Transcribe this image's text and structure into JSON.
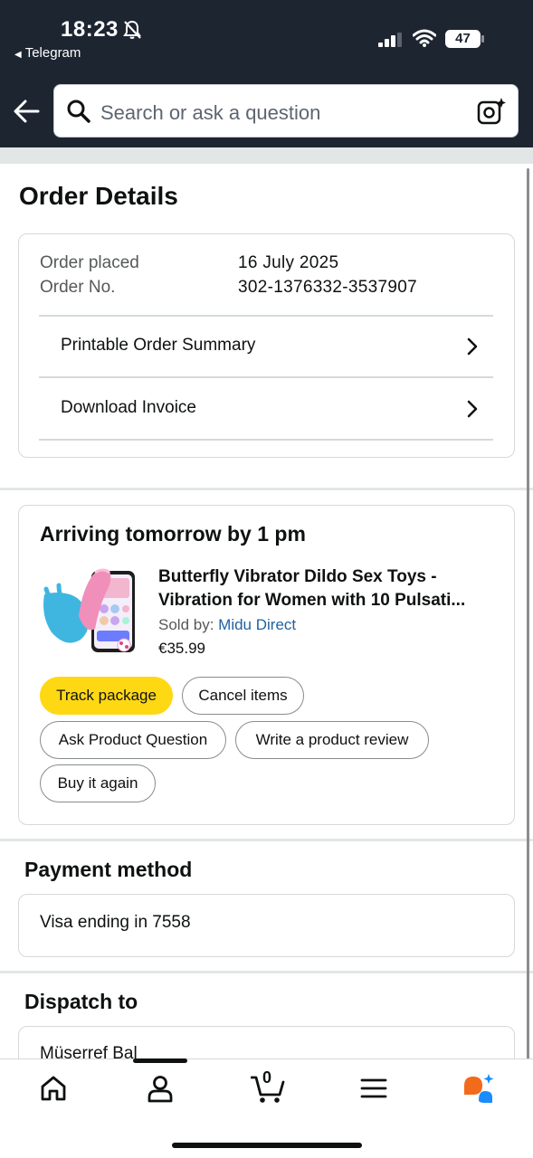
{
  "status_bar": {
    "time": "18:23",
    "back_app": "Telegram",
    "battery": "47"
  },
  "search": {
    "placeholder": "Search or ask a question"
  },
  "page": {
    "title": "Order Details"
  },
  "order_info": {
    "placed_label": "Order placed",
    "placed_value": "16 July 2025",
    "number_label": "Order No.",
    "number_value": "302-1376332-3537907",
    "links": [
      {
        "label": "Printable Order Summary"
      },
      {
        "label": "Download Invoice"
      }
    ]
  },
  "shipment": {
    "title": "Arriving tomorrow by 1 pm",
    "product_title_line1": "Butterfly Vibrator Dildo Sex Toys -",
    "product_title_line2": "Vibration for Women with 10 Pulsati...",
    "sold_by_label": "Sold by: ",
    "seller": "Midu Direct",
    "price": "€35.99",
    "buttons": {
      "track": "Track package",
      "cancel": "Cancel items",
      "ask": "Ask Product Question",
      "review": "Write a product review",
      "buy_again": "Buy it again"
    }
  },
  "payment": {
    "heading": "Payment method",
    "text": "Visa  ending in 7558"
  },
  "dispatch": {
    "heading": "Dispatch to",
    "name": "Müserref Bal"
  },
  "bottom_nav": {
    "cart_count": "0",
    "icons": [
      "home-icon",
      "account-icon",
      "cart-icon",
      "menu-icon",
      "rufus-ai-icon"
    ]
  },
  "colors": {
    "header_bg": "#1d2531",
    "primary_button": "#ffd814",
    "link": "#2162a1",
    "ai_orange": "#f26a1b",
    "ai_blue": "#1a8cff"
  }
}
